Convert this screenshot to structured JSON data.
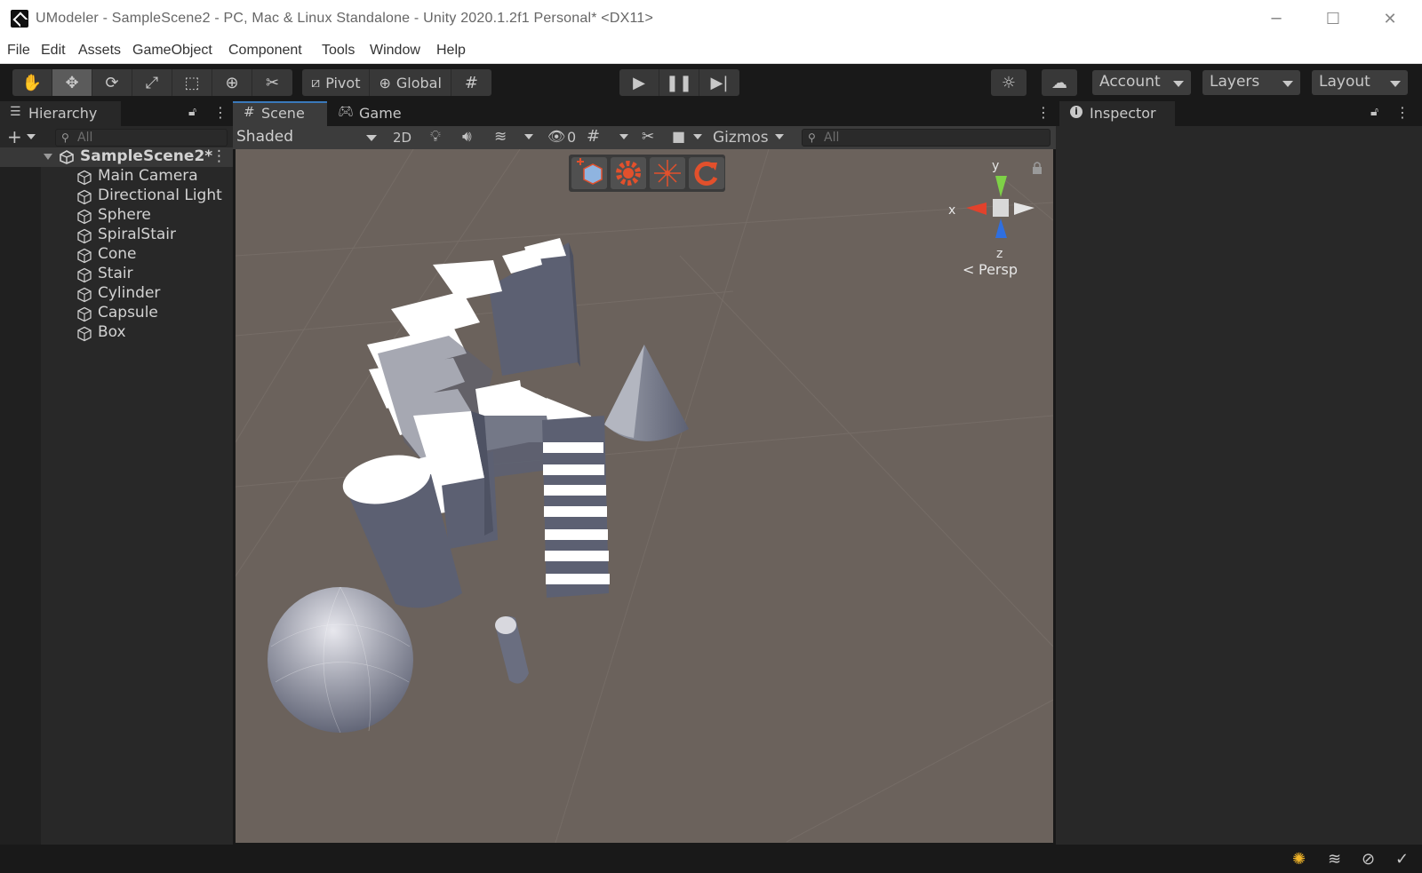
{
  "window": {
    "title": "UModeler - SampleScene2 - PC, Mac & Linux Standalone - Unity 2020.1.2f1 Personal* <DX11>",
    "minimize": "─",
    "maximize": "☐",
    "close": "✕"
  },
  "menu": [
    "File",
    "Edit",
    "Assets",
    "GameObject",
    "Component",
    "Tools",
    "Window",
    "Help"
  ],
  "toolbar": {
    "pivot": "Pivot",
    "global": "Global",
    "account": "Account",
    "layers": "Layers",
    "layout": "Layout"
  },
  "hierarchy": {
    "tab": "Hierarchy",
    "search_placeholder": "All",
    "add": "+",
    "scene": "SampleScene2*",
    "items": [
      "Main Camera",
      "Directional Light",
      "Sphere",
      "SpiralStair",
      "Cone",
      "Stair",
      "Cylinder",
      "Capsule",
      "Box"
    ]
  },
  "scene": {
    "tabs": [
      "Scene",
      "Game"
    ],
    "draw_mode": "Shaded",
    "mode_2d": "2D",
    "hidden_count": "0",
    "gizmos": "Gizmos",
    "search_placeholder": "All",
    "gizmo": {
      "x": "x",
      "y": "y",
      "z": "z",
      "projection": "Persp"
    }
  },
  "inspector": {
    "tab": "Inspector"
  },
  "colors": {
    "accent": "#3a79bb",
    "viewport": "#6b625c",
    "umodeler": "#e2502c"
  }
}
